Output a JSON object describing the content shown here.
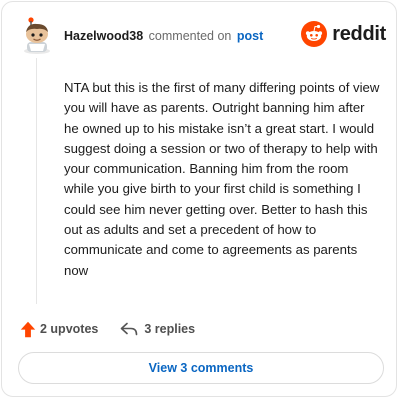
{
  "header": {
    "username": "Hazelwood38",
    "action_text": "commented on",
    "post_link": "post",
    "brand_word": "reddit"
  },
  "comment": {
    "body": "NTA but this is the first of many differing points of view you will have as parents. Outright banning him after he owned up to his mistake isn’t a great start. I would suggest doing a session or two of therapy to help with your communication. Banning him from the room while you give birth to your first child is something I could see him never getting over. Better to hash this out as adults and set a precedent of how to communicate and come to agreements as parents now"
  },
  "actions": {
    "upvotes_label": "2 upvotes",
    "replies_label": "3 replies"
  },
  "footer": {
    "view_comments_label": "View 3 comments"
  },
  "colors": {
    "accent_blue": "#0a66c2",
    "reddit_orange": "#ff4500"
  },
  "icons": {
    "avatar": "avatar",
    "brand": "reddit-logo-icon",
    "upvote": "upvote-arrow-icon",
    "reply": "reply-arrow-icon"
  }
}
